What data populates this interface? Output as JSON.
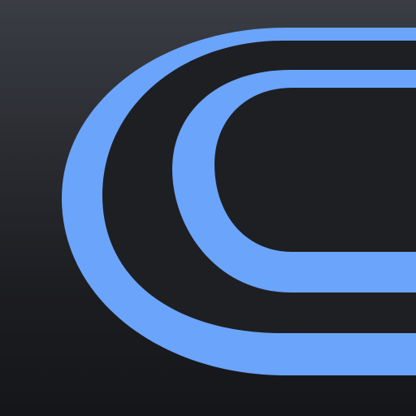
{
  "app_icon": {
    "icon_name": "track-rings-logo-icon",
    "colors": {
      "background_top": "#3a3d45",
      "background_bottom": "#151619",
      "ring": "#6ba4fb",
      "gap": "#1e1f23"
    }
  }
}
